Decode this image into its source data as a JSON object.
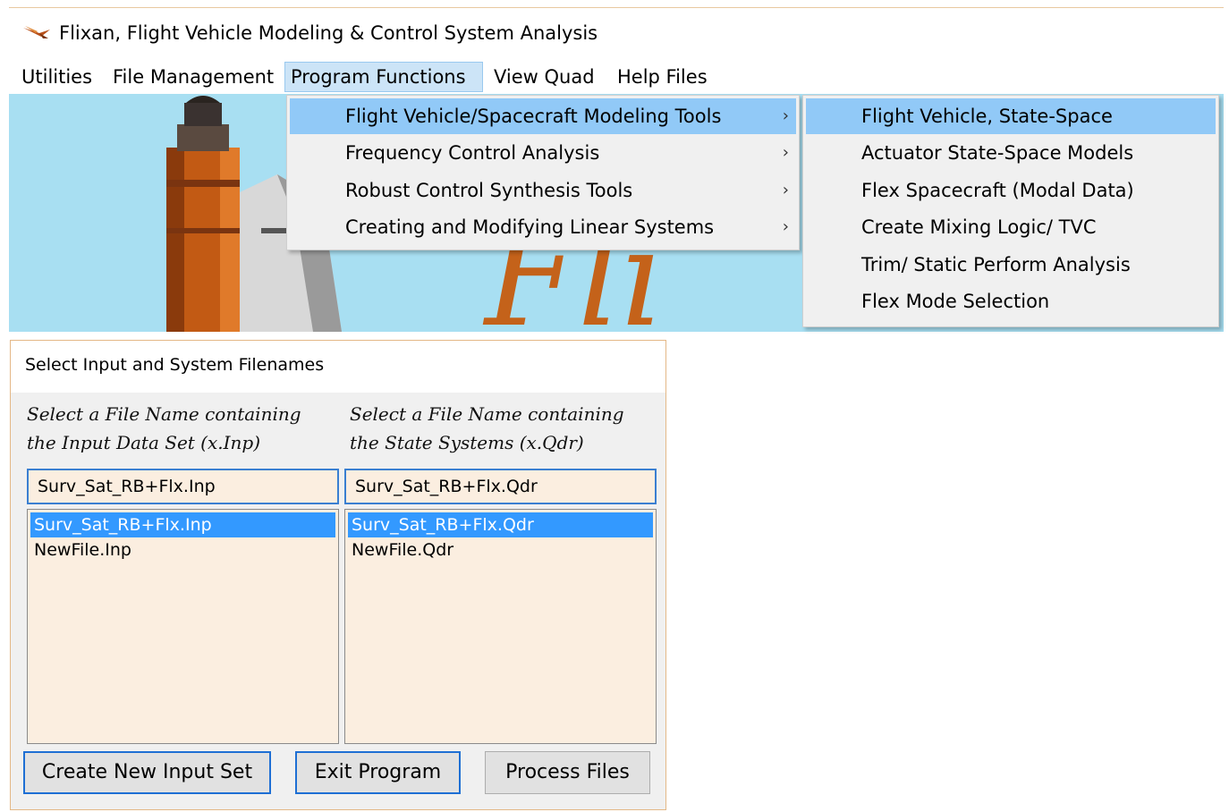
{
  "window": {
    "title": "Flixan, Flight Vehicle Modeling & Control System Analysis",
    "icon": "flixan-logo-icon"
  },
  "menu_bar": {
    "items": [
      {
        "label": "Utilities"
      },
      {
        "label": "File Management"
      },
      {
        "label": "Program Functions",
        "active": true
      },
      {
        "label": "View Quad"
      },
      {
        "label": "Help Files"
      }
    ]
  },
  "program_functions_menu": {
    "items": [
      {
        "label": "Flight Vehicle/Spacecraft Modeling Tools",
        "arrow": "›",
        "highlighted": true
      },
      {
        "label": "Frequency Control Analysis",
        "arrow": "›"
      },
      {
        "label": "Robust Control Synthesis Tools",
        "arrow": "›"
      },
      {
        "label": "Creating and Modifying Linear Systems",
        "arrow": "›"
      }
    ]
  },
  "vehicle_modeling_submenu": {
    "items": [
      {
        "label": "Flight Vehicle, State-Space",
        "highlighted": true
      },
      {
        "label": "Actuator State-Space Models"
      },
      {
        "label": "Flex Spacecraft (Modal Data)"
      },
      {
        "label": "Create Mixing Logic/ TVC"
      },
      {
        "label": "Trim/ Static Perform Analysis"
      },
      {
        "label": "Flex Mode Selection"
      }
    ]
  },
  "dialog": {
    "title": "Select Input and System Filenames",
    "input_column": {
      "caption_line1": "Select a File Name containing",
      "caption_line2": "the Input Data Set (x.Inp)",
      "field_value": "Surv_Sat_RB+Flx.Inp",
      "files": [
        "Surv_Sat_RB+Flx.Inp",
        "NewFile.Inp"
      ],
      "selected_index": 0
    },
    "system_column": {
      "caption_line1": "Select a File Name containing",
      "caption_line2": "the State Systems (x.Qdr)",
      "field_value": "Surv_Sat_RB+Flx.Qdr",
      "files": [
        "Surv_Sat_RB+Flx.Qdr",
        "NewFile.Qdr"
      ],
      "selected_index": 0
    },
    "buttons": {
      "create_new": "Create New Input Set",
      "exit": "Exit Program",
      "process": "Process Files"
    }
  },
  "colors": {
    "menu_highlight": "#91c9f7",
    "list_selection": "#3399ff",
    "field_background": "#fbeee0",
    "splash_sky": "#a8dff2",
    "splash_letters": "#c4621a"
  }
}
